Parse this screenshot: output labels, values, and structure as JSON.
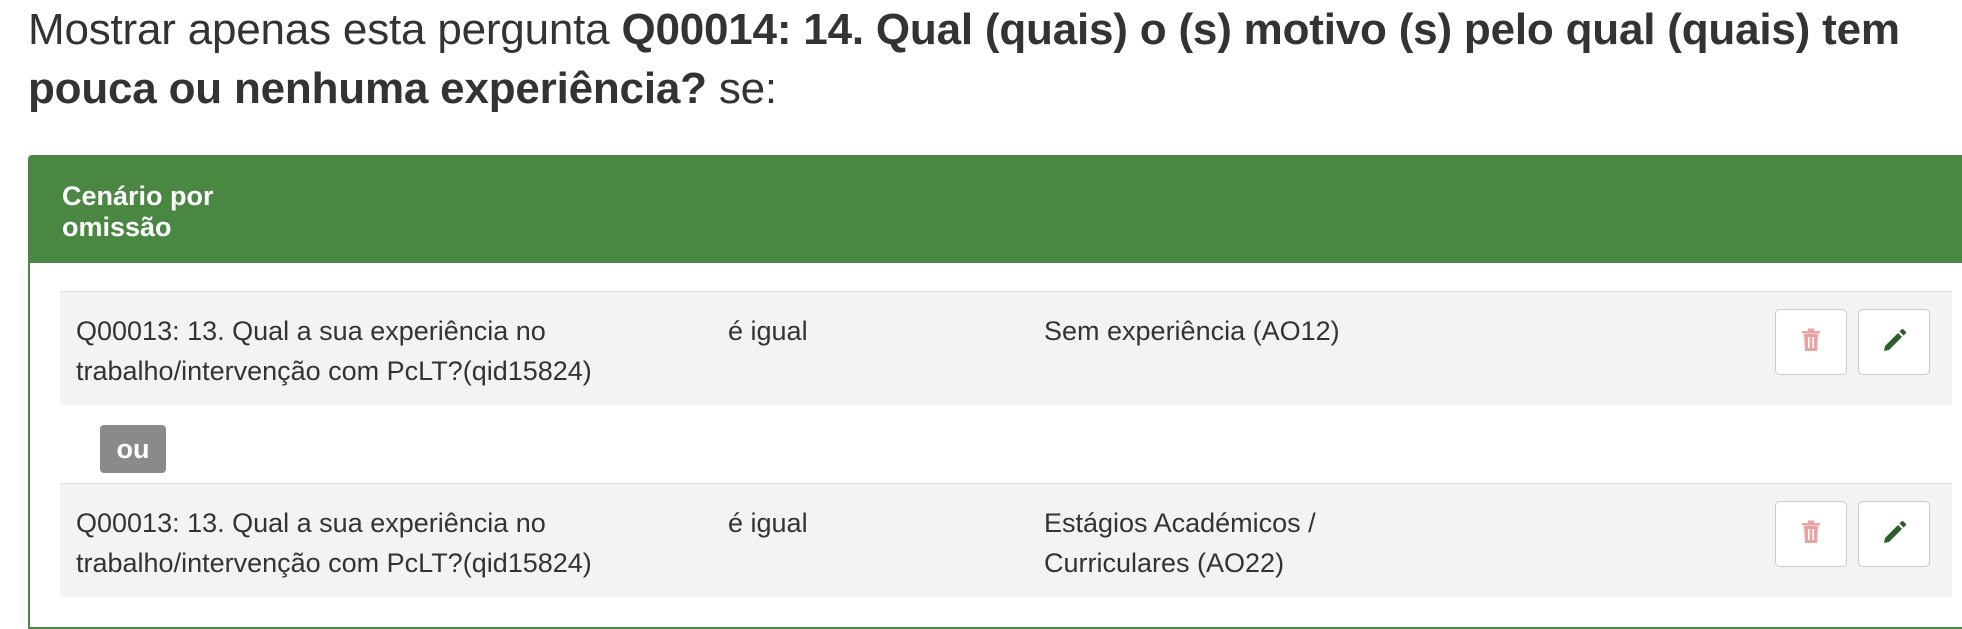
{
  "heading": {
    "prefix": "Mostrar apenas esta pergunta ",
    "question_title": "Q00014: 14. Qual (quais) o (s) motivo (s) pelo qual (quais) tem pouca ou nenhuma experiência?",
    "suffix": " se:"
  },
  "scenario": {
    "title": "Cenário por omissão",
    "conditions": [
      {
        "question": "Q00013: 13. Qual a sua experiência no trabalho/intervenção com PcLT?(qid15824)",
        "operator": "é igual",
        "value": "Sem experiência (AO12)",
        "delete_icon": "trash-icon",
        "edit_icon": "pencil-icon"
      },
      {
        "question": "Q00013: 13. Qual a sua experiência no trabalho/intervenção com PcLT?(qid15824)",
        "operator": "é igual",
        "value": "Estágios Académicos / Curriculares (AO22)",
        "delete_icon": "trash-icon",
        "edit_icon": "pencil-icon"
      }
    ],
    "connector_label": "ou"
  },
  "colors": {
    "header_green": "#4a8742",
    "delete_icon": "#e8a3a3",
    "edit_icon": "#2e5e28",
    "connector_badge": "#8a8a8a",
    "row_background": "#f3f3f3"
  }
}
